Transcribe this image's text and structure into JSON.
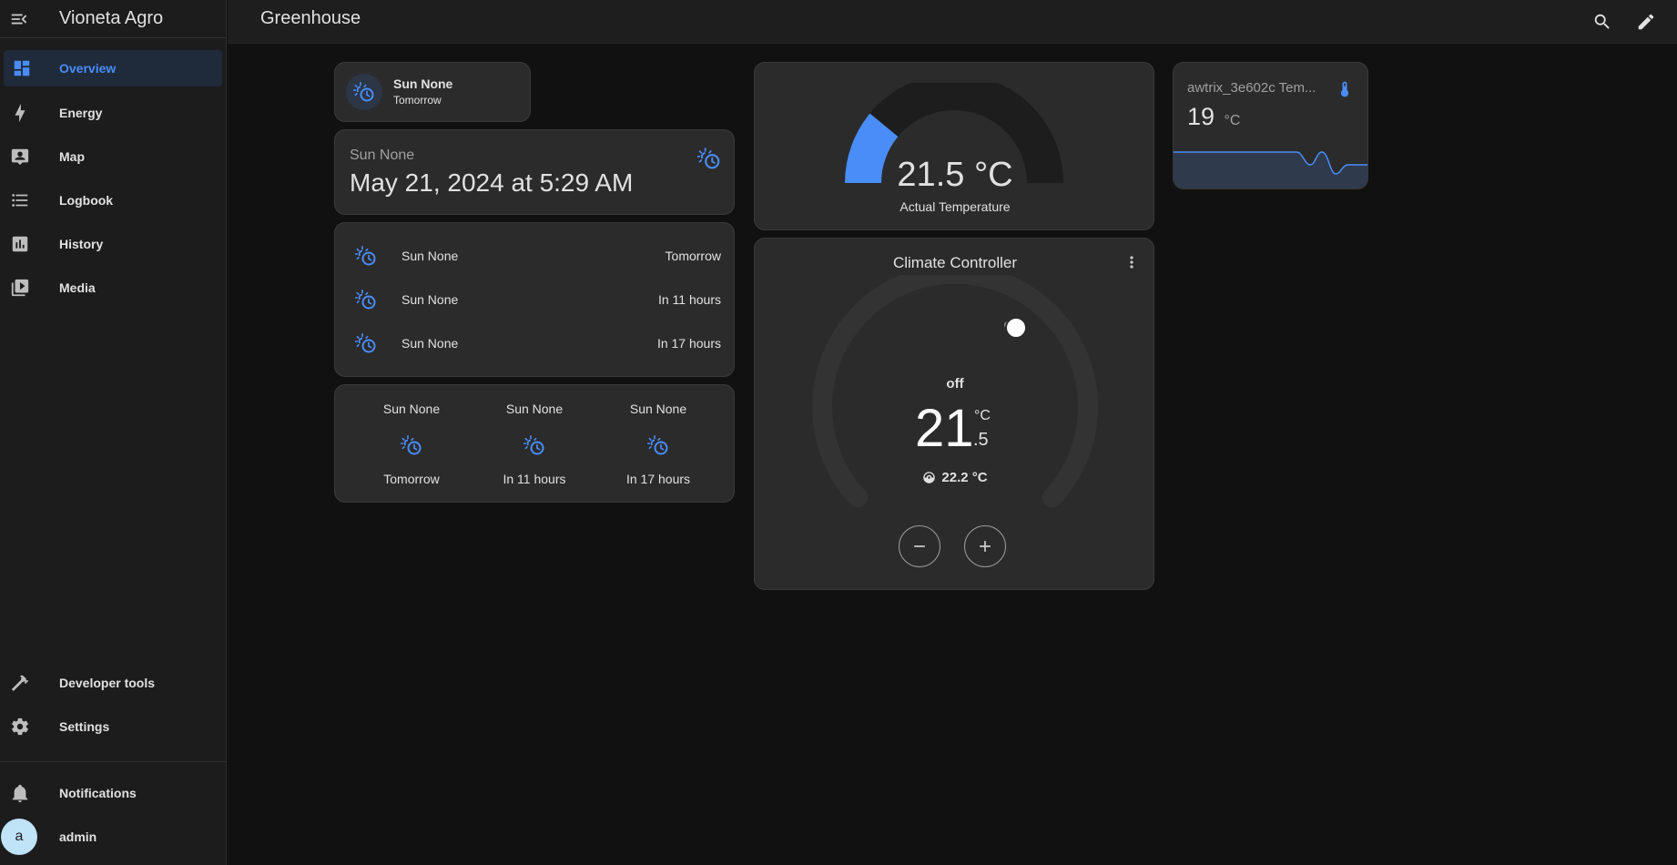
{
  "sidebar": {
    "title": "Vioneta Agro",
    "items": [
      {
        "label": "Overview",
        "icon": "view-dashboard-icon"
      },
      {
        "label": "Energy",
        "icon": "lightning-bolt-icon"
      },
      {
        "label": "Map",
        "icon": "map-account-icon"
      },
      {
        "label": "Logbook",
        "icon": "format-list-icon"
      },
      {
        "label": "History",
        "icon": "chart-box-icon"
      },
      {
        "label": "Media",
        "icon": "play-box-multiple-icon"
      }
    ],
    "bottom_items": [
      {
        "label": "Developer tools",
        "icon": "hammer-icon"
      },
      {
        "label": "Settings",
        "icon": "cog-icon"
      }
    ],
    "notifications_label": "Notifications",
    "user": {
      "name": "admin",
      "initial": "a"
    }
  },
  "header": {
    "title": "Greenhouse"
  },
  "colors": {
    "accent": "#4a8df8",
    "background": "#111111",
    "card": "#2b2b2b"
  },
  "tile": {
    "name": "Sun None",
    "state": "Tomorrow"
  },
  "entity_card": {
    "name": "Sun None",
    "value": "May 21, 2024 at 5:29 AM"
  },
  "entities_list": [
    {
      "name": "Sun None",
      "state": "Tomorrow"
    },
    {
      "name": "Sun None",
      "state": "In 11 hours"
    },
    {
      "name": "Sun None",
      "state": "In 17 hours"
    }
  ],
  "forecast": [
    {
      "name": "Sun None",
      "state": "Tomorrow"
    },
    {
      "name": "Sun None",
      "state": "In 11 hours"
    },
    {
      "name": "Sun None",
      "state": "In 17 hours"
    }
  ],
  "gauge": {
    "value_text": "21.5 °C",
    "label": "Actual Temperature",
    "fill_fraction": 0.22
  },
  "thermostat": {
    "title": "Climate Controller",
    "mode": "off",
    "target_whole": "21",
    "target_unit": "°C",
    "target_decimal": ".5",
    "current_text": "22.2 °C"
  },
  "sensor": {
    "name": "awtrix_3e602c Tem...",
    "value": "19",
    "unit": "°C"
  }
}
